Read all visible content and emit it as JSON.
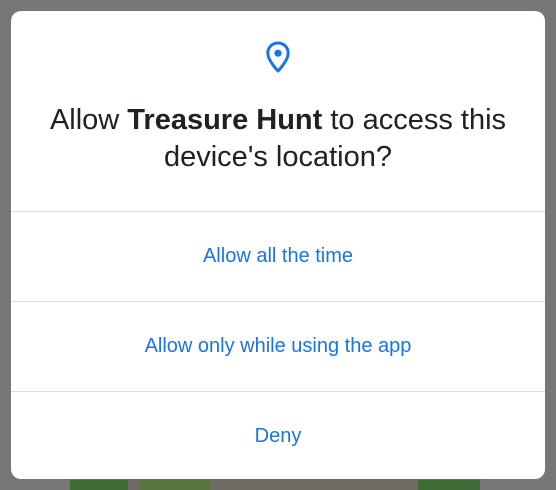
{
  "permission_dialog": {
    "icon": "location-pin-icon",
    "accent_color": "#1a73e8",
    "title_prefix": "Allow ",
    "app_name": "Treasure Hunt",
    "title_suffix": " to access this device's location?",
    "options": [
      {
        "label": "Allow all the time"
      },
      {
        "label": "Allow only while using the app"
      },
      {
        "label": "Deny"
      }
    ]
  }
}
